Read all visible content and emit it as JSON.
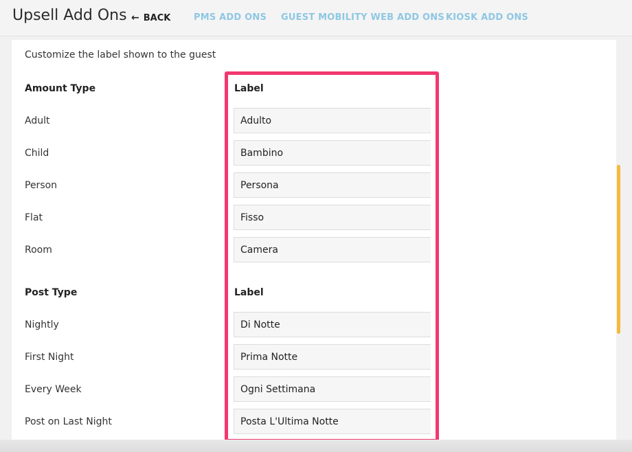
{
  "header": {
    "title": "Upsell Add Ons",
    "back_label": "BACK",
    "tabs": [
      {
        "label": "PMS ADD ONS"
      },
      {
        "label": "GUEST MOBILITY WEB ADD ONS"
      },
      {
        "label": "KIOSK ADD ONS"
      }
    ]
  },
  "content": {
    "intro": "Customize the label shown to the guest",
    "amount_section": {
      "type_header": "Amount Type",
      "label_header": "Label",
      "rows": [
        {
          "type": "Adult",
          "label": "Adulto"
        },
        {
          "type": "Child",
          "label": "Bambino"
        },
        {
          "type": "Person",
          "label": "Persona"
        },
        {
          "type": "Flat",
          "label": "Fisso"
        },
        {
          "type": "Room",
          "label": "Camera"
        }
      ]
    },
    "post_section": {
      "type_header": "Post Type",
      "label_header": "Label",
      "rows": [
        {
          "type": "Nightly",
          "label": "Di Notte"
        },
        {
          "type": "First Night",
          "label": "Prima Notte"
        },
        {
          "type": "Every Week",
          "label": "Ogni Settimana"
        },
        {
          "type": "Post on Last Night",
          "label": "Posta L'Ultima Notte"
        }
      ]
    }
  },
  "colors": {
    "tab_text": "#8ec7e3",
    "highlight": "#f2386f",
    "scrollbar": "#f5b93b"
  }
}
